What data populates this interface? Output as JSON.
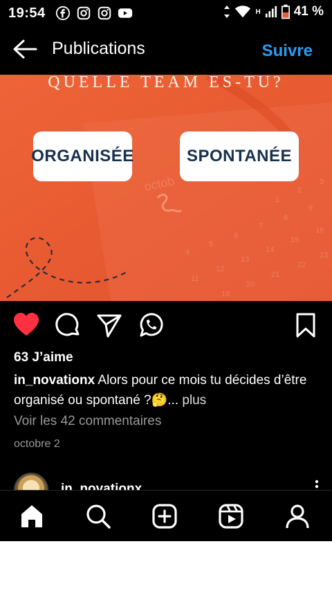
{
  "status_bar": {
    "time": "19:54",
    "app_icons": [
      "facebook-icon",
      "instagram-icon",
      "instagram-icon",
      "youtube-icon"
    ],
    "network": "H",
    "battery": "41 %"
  },
  "header": {
    "title": "Publications",
    "follow_label": "Suivre"
  },
  "post": {
    "headline": "QUELLE TEAM ES-TU?",
    "option_a": "ORGANISÉE",
    "option_b": "SPONTANÉE",
    "calendar_month": "octob",
    "likes": "63 J’aime",
    "author": "in_novationx",
    "caption": " Alors pour ce mois tu décides d’être organisé ou spontané ?🤔... ",
    "more_label": "plus",
    "comments_link": "Voir les 42 commentaires",
    "date": "octobre 2",
    "liked": true,
    "colors": {
      "image_bg": "#ea5a2e",
      "like_red": "#ff3040",
      "follow_blue": "#2d9bf0"
    }
  },
  "next_post": {
    "author": "in_novationx"
  },
  "nav": {
    "items": [
      "home-icon",
      "search-icon",
      "create-icon",
      "reels-icon",
      "profile-icon"
    ]
  }
}
